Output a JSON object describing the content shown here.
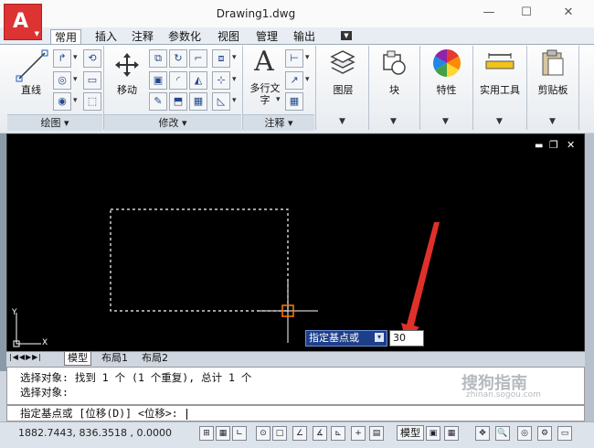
{
  "window": {
    "title": "Drawing1.dwg",
    "controls": {
      "minimize": "—",
      "maximize": "☐",
      "close": "✕"
    }
  },
  "app_button": {
    "glyph": "A",
    "icon": "autocad-logo-icon"
  },
  "ribbon_tabs": [
    "常用",
    "插入",
    "注释",
    "参数化",
    "视图",
    "管理",
    "输出"
  ],
  "ribbon": {
    "draw_panel": {
      "title": "绘图",
      "line_label": "直线"
    },
    "modify_panel": {
      "title": "修改",
      "move_label": "移动"
    },
    "annotation_panel": {
      "title": "注释",
      "mtext_label": "多行文字"
    },
    "big_buttons": [
      {
        "label": "图层",
        "icon": "layers-icon"
      },
      {
        "label": "块",
        "icon": "block-icon"
      },
      {
        "label": "特性",
        "icon": "color-wheel-icon"
      },
      {
        "label": "实用工具",
        "icon": "measure-icon"
      },
      {
        "label": "剪贴板",
        "icon": "clipboard-icon"
      }
    ]
  },
  "viewport_controls": {
    "minimize": "▬",
    "restore": "❐",
    "close": "✕"
  },
  "ucs": {
    "x": "X",
    "y": "Y"
  },
  "layout_tabs": [
    "模型",
    "布局1",
    "布局2"
  ],
  "dynamic_input": {
    "prompt": "指定基点或",
    "value": "30"
  },
  "command_history": [
    "选择对象: 找到 1 个 (1 个重复), 总计 1 个",
    "选择对象:"
  ],
  "command_prompt": "指定基点或 [位移(D)] <位移>:",
  "status_bar": {
    "coordinates": "1882.7443, 836.3518 , 0.0000",
    "model_label": "模型"
  },
  "watermark": {
    "text": "搜狗指南",
    "subtext": "zhinan.sogou.com"
  },
  "colors": {
    "canvas": "#000000",
    "crosshair": "#ffffff",
    "selection": "#ffffff",
    "snap_marker": "#ff7f00",
    "arrow": "#e0302a",
    "app_button": "#dd3333"
  }
}
